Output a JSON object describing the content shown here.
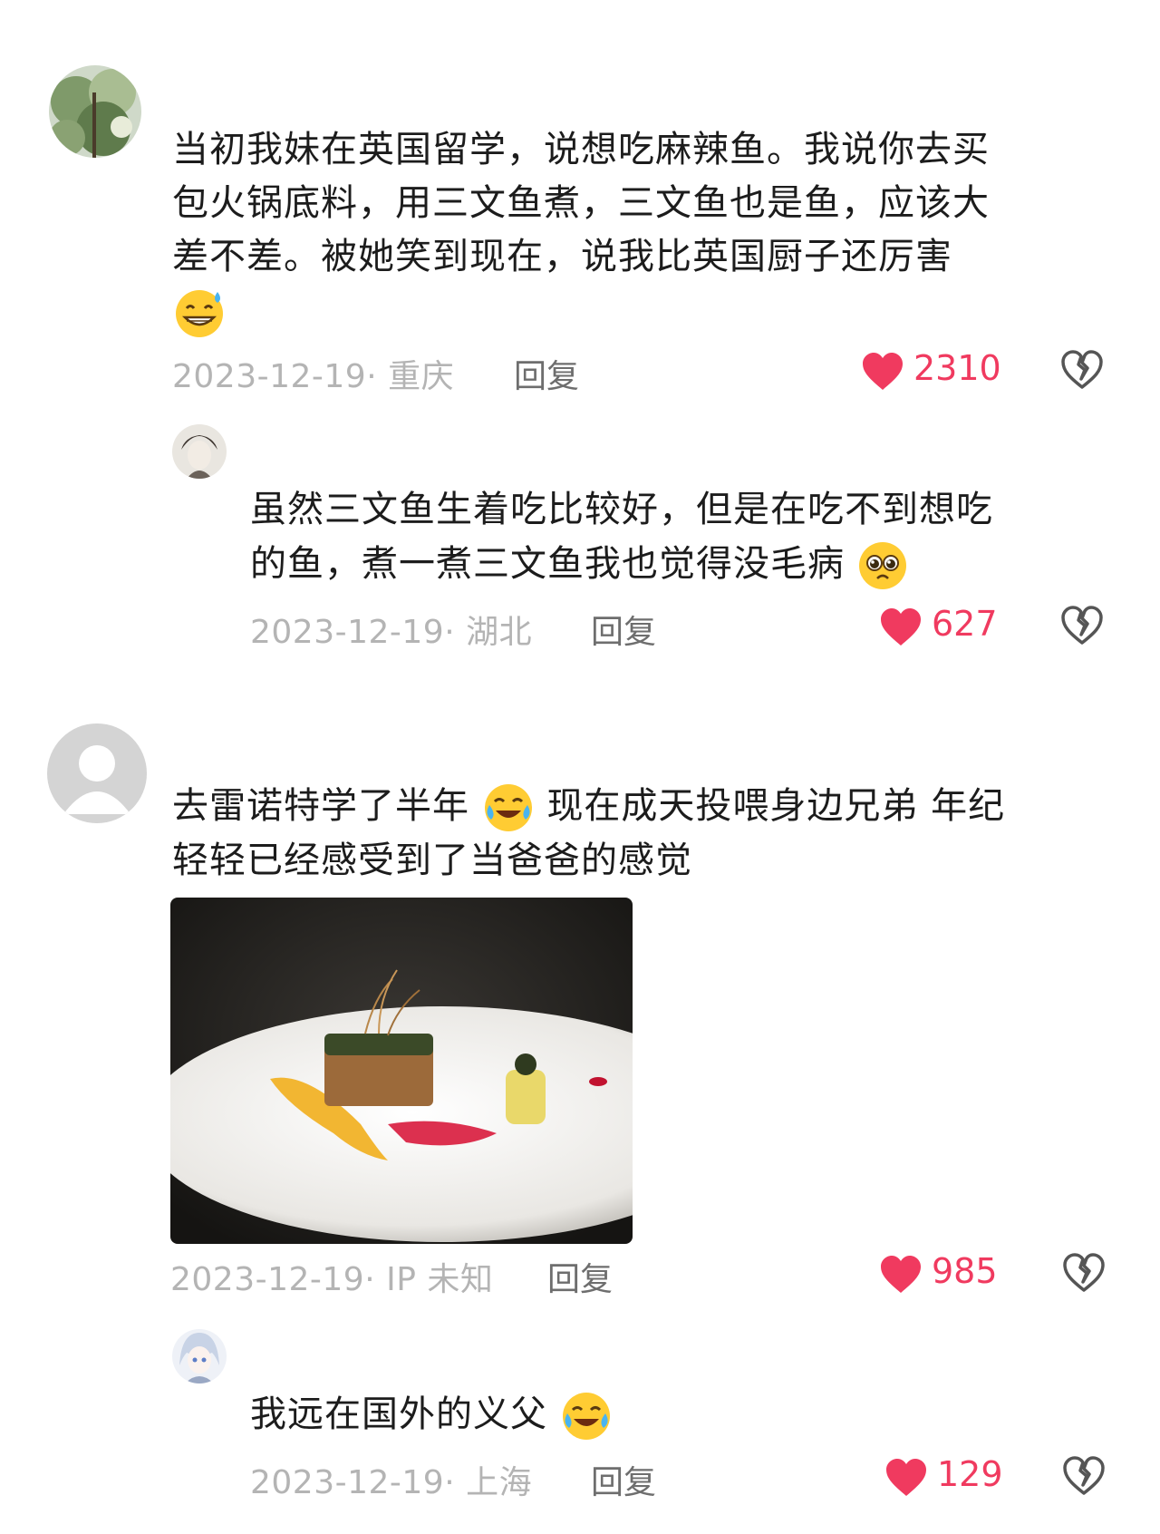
{
  "colors": {
    "like": "#f03a5f",
    "meta": "#b4b4b4",
    "text": "#1c1c1c",
    "reply_link": "#6e6e6e"
  },
  "icons": {
    "like": "heart-icon",
    "dislike": "broken-heart-icon"
  },
  "comments": [
    {
      "text_lines": [
        "当初我妹在英国留学，说想吃麻辣鱼。我说你去买",
        "包火锅底料，用三文鱼煮，三文鱼也是鱼，应该大",
        "差不差。被她笑到现在，说我比英国厨子还厉害"
      ],
      "emoji": "grinning-sweat-emoji",
      "meta": "2023-12-19· 重庆",
      "reply_label": "回复",
      "likes": "2310",
      "replies": [
        {
          "text_lines": [
            "虽然三文鱼生着吃比较好，但是在吃不到想吃",
            "的鱼，煮一煮三文鱼我也觉得没毛病"
          ],
          "emoji": "pleading-emoji",
          "meta": "2023-12-19· 湖北",
          "reply_label": "回复",
          "likes": "627"
        }
      ]
    },
    {
      "text_line1_a": "去雷诺特学了半年",
      "text_line1_b": "现在成天投喂身边兄弟 年纪",
      "text_line2": "轻轻已经感受到了当爸爸的感觉",
      "emoji": "crying-laughing-emoji",
      "photo": "plated-dish-photo",
      "meta": "2023-12-19· IP 未知",
      "reply_label": "回复",
      "likes": "985",
      "replies": [
        {
          "text": "我远在国外的义父",
          "emoji": "crying-laughing-emoji",
          "meta": "2023-12-19· 上海",
          "reply_label": "回复",
          "likes": "129"
        }
      ]
    }
  ]
}
